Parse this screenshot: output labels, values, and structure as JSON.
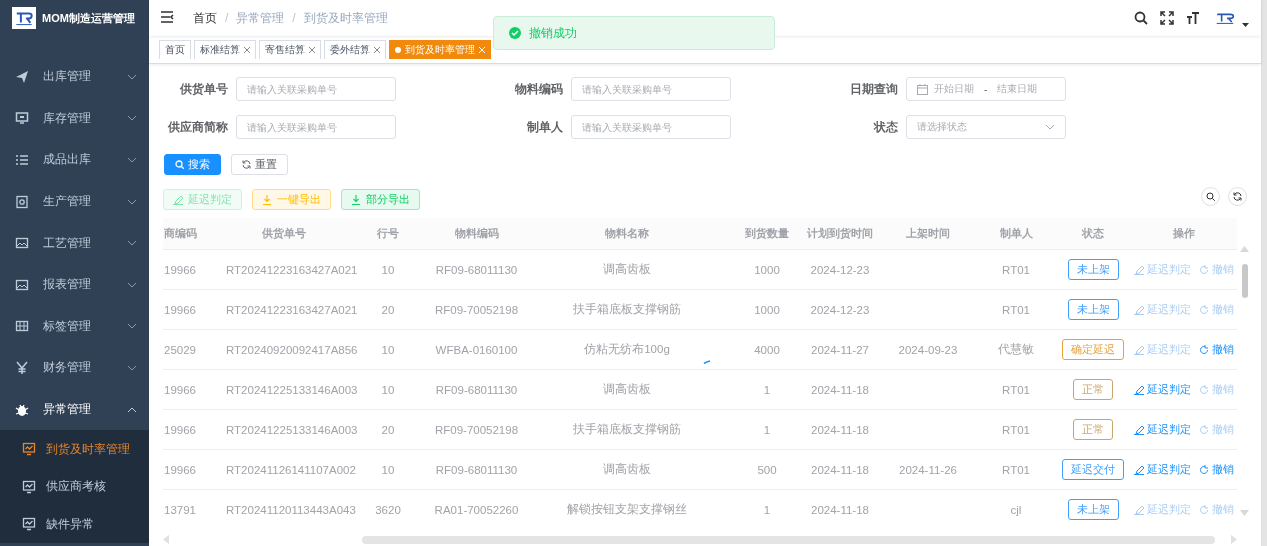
{
  "sidebar": {
    "title": "MOM制造运营管理",
    "items": [
      {
        "label": "出库管理",
        "expanded": false
      },
      {
        "label": "库存管理",
        "expanded": false
      },
      {
        "label": "成品出库",
        "expanded": false
      },
      {
        "label": "生产管理",
        "expanded": false
      },
      {
        "label": "工艺管理",
        "expanded": false
      },
      {
        "label": "报表管理",
        "expanded": false
      },
      {
        "label": "标签管理",
        "expanded": false
      },
      {
        "label": "财务管理",
        "expanded": false
      },
      {
        "label": "异常管理",
        "expanded": true,
        "children": [
          {
            "label": "到货及时率管理",
            "selected": true
          },
          {
            "label": "供应商考核",
            "selected": false
          },
          {
            "label": "缺件异常",
            "selected": false
          }
        ]
      }
    ]
  },
  "header": {
    "breadcrumb": [
      "首页",
      "异常管理",
      "到货及时率管理"
    ],
    "separator": "/"
  },
  "tags": [
    {
      "label": "首页",
      "selected": false,
      "closable": false
    },
    {
      "label": "标准结算",
      "selected": false,
      "closable": true
    },
    {
      "label": "寄售结算",
      "selected": false,
      "closable": true
    },
    {
      "label": "委外结算",
      "selected": false,
      "closable": true
    },
    {
      "label": "到货及时率管理",
      "selected": true,
      "closable": true
    }
  ],
  "toast": {
    "kind": "success",
    "text": "撤销成功"
  },
  "form": {
    "fields": [
      {
        "kind": "input",
        "label": "供货单号",
        "placeholder": "请输入关联采购单号"
      },
      {
        "kind": "input",
        "label": "物料编码",
        "placeholder": "请输入关联采购单号"
      },
      {
        "kind": "daterange",
        "label": "日期查询",
        "start_placeholder": "开始日期",
        "separator": "-",
        "end_placeholder": "结束日期"
      },
      {
        "kind": "input",
        "label": "供应商简称",
        "placeholder": "请输入关联采购单号"
      },
      {
        "kind": "input",
        "label": "制单人",
        "placeholder": "请输入关联采购单号"
      },
      {
        "kind": "select",
        "label": "状态",
        "placeholder": "请选择状态"
      }
    ],
    "buttons": [
      {
        "kind": "primary",
        "label": "搜索"
      },
      {
        "kind": "default",
        "label": "重置"
      }
    ]
  },
  "toolbar": {
    "buttons": [
      {
        "kind": "success",
        "label": "延迟判定",
        "disabled": true
      },
      {
        "kind": "warning",
        "label": "一键导出",
        "disabled": false
      },
      {
        "kind": "success",
        "label": "部分导出",
        "disabled": false
      }
    ]
  },
  "table": {
    "columns": [
      "商编码",
      "供货单号",
      "行号",
      "物料编码",
      "物料名称",
      "到货数量",
      "计划到货时间",
      "上架时间",
      "制单人",
      "状态",
      "操作"
    ],
    "rows": [
      {
        "cells": [
          "19966",
          "RT20241223163427A021",
          "10",
          "RF09-68011130",
          "调高齿板",
          "1000",
          "2024-12-23",
          "",
          "RT01"
        ],
        "status": {
          "text": "未上架",
          "color": "#409eff"
        },
        "actions": [
          {
            "label": "延迟判定",
            "disabled": true
          },
          {
            "label": "撤销",
            "disabled": true
          }
        ]
      },
      {
        "cells": [
          "19966",
          "RT20241223163427A021",
          "20",
          "RF09-70052198",
          "扶手箱底板支撑钢筋",
          "1000",
          "2024-12-23",
          "",
          "RT01"
        ],
        "status": {
          "text": "未上架",
          "color": "#409eff"
        },
        "actions": [
          {
            "label": "延迟判定",
            "disabled": true
          },
          {
            "label": "撤销",
            "disabled": true
          }
        ]
      },
      {
        "cells": [
          "25029",
          "RT20240920092417A856",
          "10",
          "WFBA-0160100",
          "仿粘无纺布100g",
          "4000",
          "2024-11-27",
          "2024-09-23",
          "代慧敏"
        ],
        "status": {
          "text": "确定延迟",
          "color": "#e6a23c"
        },
        "actions": [
          {
            "label": "延迟判定",
            "disabled": true
          },
          {
            "label": "撤销",
            "disabled": false
          }
        ]
      },
      {
        "cells": [
          "19966",
          "RT20241225133146A003",
          "10",
          "RF09-68011130",
          "调高齿板",
          "1",
          "2024-11-18",
          "",
          "RT01"
        ],
        "status": {
          "text": "正常",
          "color": "#c9a66b"
        },
        "actions": [
          {
            "label": "延迟判定",
            "disabled": false
          },
          {
            "label": "撤销",
            "disabled": true
          }
        ]
      },
      {
        "cells": [
          "19966",
          "RT20241225133146A003",
          "20",
          "RF09-70052198",
          "扶手箱底板支撑钢筋",
          "1",
          "2024-11-18",
          "",
          "RT01"
        ],
        "status": {
          "text": "正常",
          "color": "#c9a66b"
        },
        "actions": [
          {
            "label": "延迟判定",
            "disabled": false
          },
          {
            "label": "撤销",
            "disabled": true
          }
        ]
      },
      {
        "cells": [
          "19966",
          "RT20241126141107A002",
          "10",
          "RF09-68011130",
          "调高齿板",
          "500",
          "2024-11-18",
          "2024-11-26",
          "RT01"
        ],
        "status": {
          "text": "延迟交付",
          "color": "#409eff"
        },
        "actions": [
          {
            "label": "延迟判定",
            "disabled": false
          },
          {
            "label": "撤销",
            "disabled": false
          }
        ]
      },
      {
        "cells": [
          "13791",
          "RT20241120113443A043",
          "3620",
          "RA01-70052260",
          "解锁按钮支架支撑钢丝",
          "1",
          "2024-11-18",
          "",
          "cjl"
        ],
        "status": {
          "text": "未上架",
          "color": "#409eff"
        },
        "actions": [
          {
            "label": "延迟判定",
            "disabled": true
          },
          {
            "label": "撤销",
            "disabled": true
          }
        ]
      }
    ]
  }
}
